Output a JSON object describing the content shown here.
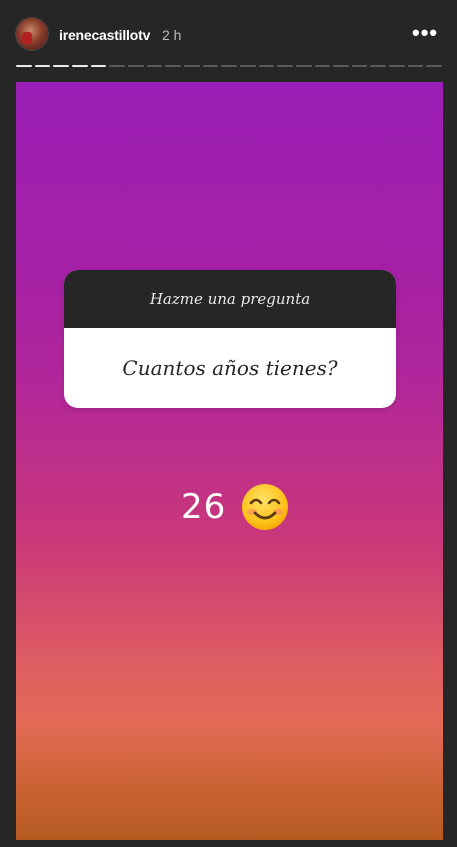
{
  "header": {
    "username": "irenecastillotv",
    "time": "2 h",
    "more_icon": "more-horizontal-icon"
  },
  "progress": {
    "total_segments": 23,
    "completed_segments": 5
  },
  "story": {
    "question_sticker": {
      "header": "Hazme una pregunta",
      "question": "Cuantos años tienes?"
    },
    "answer": {
      "text": "26",
      "emoji": "smiling-face-icon"
    },
    "gradient_colors": [
      "#9b1fb6",
      "#c9377a",
      "#e36a55",
      "#b65a22"
    ]
  }
}
